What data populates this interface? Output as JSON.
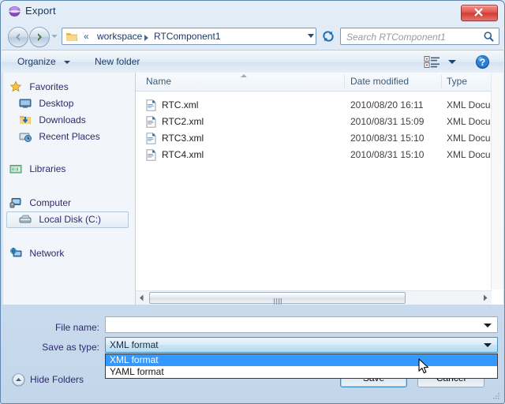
{
  "window": {
    "title": "Export",
    "title_icon": "globe-icon",
    "close_label": "Close"
  },
  "nav": {
    "back_icon": "arrow-left-icon",
    "forward_icon": "arrow-right-icon",
    "recent_icon": "chevron-down-icon",
    "refresh_icon": "refresh-icon",
    "breadcrumb_separator": "«",
    "breadcrumbs": [
      {
        "label": "workspace"
      },
      {
        "label": "RTComponent1"
      }
    ],
    "address_folder_icon": "folder-icon",
    "address_dropdown_icon": "chevron-down-icon"
  },
  "search": {
    "placeholder": "Search RTComponent1",
    "icon": "search-icon"
  },
  "toolbar": {
    "organize_label": "Organize",
    "new_folder_label": "New folder",
    "view_mode_icon": "view-list-icon",
    "view_mode_caret_icon": "chevron-down-icon",
    "help_icon": "help-icon"
  },
  "sidebar": {
    "items": [
      {
        "label": "Favorites",
        "icon": "star-icon",
        "indent": false,
        "selected": false
      },
      {
        "label": "Desktop",
        "icon": "desktop-icon",
        "indent": true,
        "selected": false
      },
      {
        "label": "Downloads",
        "icon": "downloads-icon",
        "indent": true,
        "selected": false
      },
      {
        "label": "Recent Places",
        "icon": "recent-places-icon",
        "indent": true,
        "selected": false
      },
      {
        "label": "Libraries",
        "icon": "libraries-icon",
        "indent": false,
        "selected": false
      },
      {
        "label": "Computer",
        "icon": "computer-icon",
        "indent": false,
        "selected": false
      },
      {
        "label": "Local Disk (C:)",
        "icon": "harddisk-icon",
        "indent": true,
        "selected": true
      },
      {
        "label": "Network",
        "icon": "network-icon",
        "indent": false,
        "selected": false
      }
    ]
  },
  "filelist": {
    "columns": [
      {
        "label": "Name",
        "sorted": "ascending"
      },
      {
        "label": "Date modified",
        "sorted": ""
      },
      {
        "label": "Type",
        "sorted": ""
      }
    ],
    "rows": [
      {
        "name": "RTC.xml",
        "date": "2010/08/20 16:11",
        "type": "XML Docum",
        "icon": "xml-file-icon"
      },
      {
        "name": "RTC2.xml",
        "date": "2010/08/31 15:09",
        "type": "XML Docum",
        "icon": "xml-file-icon"
      },
      {
        "name": "RTC3.xml",
        "date": "2010/08/31 15:10",
        "type": "XML Docum",
        "icon": "xml-file-icon"
      },
      {
        "name": "RTC4.xml",
        "date": "2010/08/31 15:10",
        "type": "XML Docum",
        "icon": "xml-file-icon"
      }
    ],
    "hscroll_left_icon": "triangle-left-icon",
    "hscroll_right_icon": "triangle-right-icon"
  },
  "form": {
    "filename_label": "File name:",
    "filename_value": "",
    "savetype_label": "Save as type:",
    "savetype_value": "XML format",
    "savetype_options": [
      {
        "label": "XML format",
        "selected": true
      },
      {
        "label": "YAML format",
        "selected": false
      }
    ],
    "hide_folders_label": "Hide Folders",
    "hide_folders_icon": "chevron-up-circle-icon",
    "save_label": "Save",
    "cancel_label": "Cancel"
  },
  "colors": {
    "accent": "#3399ff",
    "title_text": "#15355e",
    "close_button": "#cf3b32",
    "sidebar_text": "#2b2b6e"
  }
}
